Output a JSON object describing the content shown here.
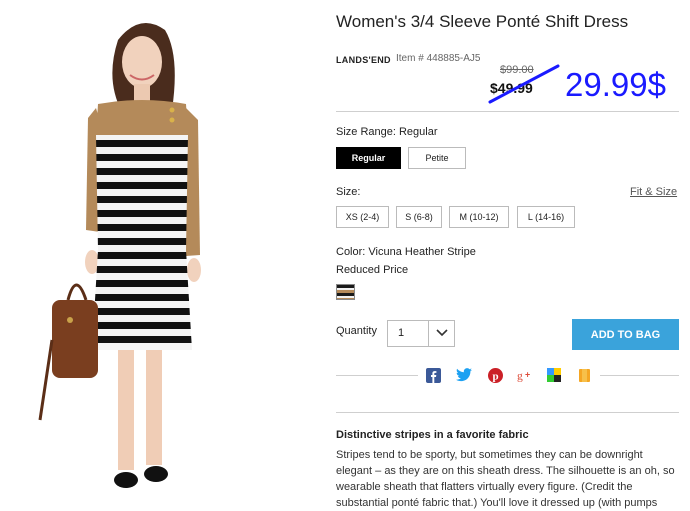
{
  "product": {
    "title": "Women's 3/4 Sleeve Ponté Shift Dress",
    "brand": "LANDS'END",
    "item_number": "Item # 448885-AJ5",
    "original_price": "$99.00",
    "current_price": "$49.99",
    "new_price": "29.99$"
  },
  "size_range": {
    "label": "Size Range: Regular",
    "options": [
      "Regular",
      "Petite"
    ],
    "selected": "Regular"
  },
  "size": {
    "label": "Size:",
    "fit_link": "Fit & Size",
    "options": [
      "XS (2-4)",
      "S (6-8)",
      "M (10-12)",
      "L (14-16)"
    ]
  },
  "color": {
    "label": "Color: Vicuna Heather Stripe",
    "note": "Reduced Price"
  },
  "quantity": {
    "label": "Quantity",
    "value": "1"
  },
  "add_to_bag": "ADD TO BAG",
  "share_icons": [
    "facebook-icon",
    "twitter-icon",
    "pinterest-icon",
    "google-plus-icon",
    "delicious-icon",
    "bookmark-icon"
  ],
  "description": {
    "title": "Distinctive stripes in a favorite fabric",
    "text": "Stripes tend to be sporty, but sometimes they can be downright elegant – as they are on this sheath dress. The silhouette is an oh, so wearable sheath that flatters virtually every figure. (Credit the substantial ponté fabric that.) You'll love it dressed up (with pumps"
  },
  "colors": {
    "accent": "#3aa3db",
    "new_price": "#1a1aff"
  }
}
